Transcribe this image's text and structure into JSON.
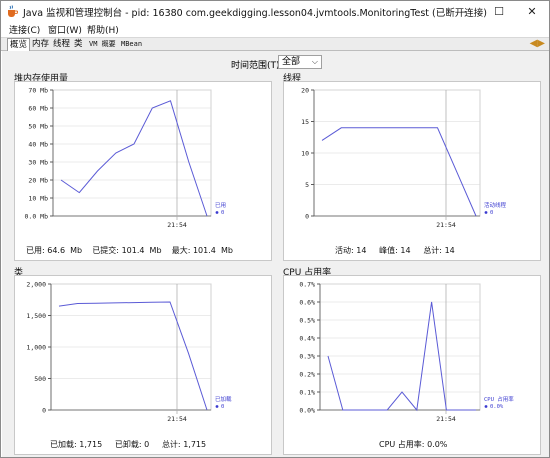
{
  "window": {
    "title": "Java 监视和管理控制台 - pid: 16380 com.geekdigging.lesson04.jvmtools.MonitoringTest (已断开连接)",
    "controls": {
      "minimize": "–",
      "maximize": "☐",
      "close": "✕"
    }
  },
  "menubar": [
    "连接(C)",
    "窗口(W)",
    "帮助(H)"
  ],
  "tabs": [
    "概览",
    "内存",
    "线程",
    "类",
    "VM 概要",
    "MBean"
  ],
  "active_tab": "概览",
  "time_range": {
    "label": "时间范围(T):",
    "value": "全部"
  },
  "panels": {
    "heap": {
      "title": "堆内存使用量",
      "legend_label": "已用",
      "legend_value": "0",
      "x_tick": "21:54",
      "stats": {
        "used_label": "已用:",
        "used_value": "64.6  Mb",
        "committed_label": "已提交:",
        "committed_value": "101.4  Mb",
        "max_label": "最大:",
        "max_value": "101.4  Mb"
      }
    },
    "threads": {
      "title": "线程",
      "legend_label": "活动线程",
      "legend_value": "0",
      "x_tick": "21:54",
      "stats": {
        "live_label": "活动:",
        "live_value": "14",
        "peak_label": "峰值:",
        "peak_value": "14",
        "total_label": "总计:",
        "total_value": "14"
      }
    },
    "classes": {
      "title": "类",
      "legend_label": "已加载",
      "legend_value": "0",
      "x_tick": "21:54",
      "stats": {
        "loaded_label": "已加载:",
        "loaded_value": "1,715",
        "unloaded_label": "已卸载:",
        "unloaded_value": "0",
        "total_label": "总计:",
        "total_value": "1,715"
      }
    },
    "cpu": {
      "title": "CPU 占用率",
      "legend_label": "CPU 占用率",
      "legend_value": "0.0%",
      "x_tick": "21:54",
      "stats": {
        "usage_label": "CPU 占用率:",
        "usage_value": "0.0%"
      }
    }
  },
  "colors": {
    "series": "#5b5bd6",
    "legend": "#3a3ad0",
    "grid": "#d8d8d8",
    "cursor": "#b0b0b0"
  },
  "chart_data": [
    {
      "type": "line",
      "title": "堆内存使用量",
      "series": [
        {
          "name": "已用",
          "x": [
            0,
            1,
            2,
            3,
            4,
            5,
            6,
            7,
            8
          ],
          "values": [
            20,
            13,
            25,
            35,
            40,
            60,
            64,
            30,
            0
          ]
        }
      ],
      "yticks": [
        "0.0 Mb",
        "10 Mb",
        "20 Mb",
        "30 Mb",
        "40 Mb",
        "50 Mb",
        "60 Mb",
        "70 Mb"
      ],
      "ylim": [
        0,
        70
      ]
    },
    {
      "type": "line",
      "title": "线程",
      "series": [
        {
          "name": "活动线程",
          "x": [
            0,
            1,
            2,
            3,
            4,
            5,
            6,
            7,
            8
          ],
          "values": [
            12,
            14,
            14,
            14,
            14,
            14,
            14,
            7,
            0
          ]
        }
      ],
      "yticks": [
        "0",
        "5",
        "10",
        "15",
        "20"
      ],
      "ylim": [
        0,
        20
      ]
    },
    {
      "type": "line",
      "title": "类",
      "series": [
        {
          "name": "已加载",
          "x": [
            0,
            1,
            2,
            3,
            4,
            5,
            6,
            7,
            8
          ],
          "values": [
            1650,
            1690,
            1695,
            1700,
            1705,
            1710,
            1715,
            900,
            0
          ]
        }
      ],
      "yticks": [
        "0",
        "500",
        "1,000",
        "1,500",
        "2,000"
      ],
      "ylim": [
        0,
        2000
      ]
    },
    {
      "type": "line",
      "title": "CPU 占用率",
      "series": [
        {
          "name": "CPU 占用率",
          "x": [
            0,
            1,
            2,
            3,
            4,
            5,
            6,
            7,
            8,
            9,
            10
          ],
          "values": [
            0.3,
            0.0,
            0.0,
            0.0,
            0.0,
            0.1,
            0.0,
            0.6,
            0.0,
            0.0,
            0.0
          ]
        }
      ],
      "yticks": [
        "0.0%",
        "0.1%",
        "0.2%",
        "0.3%",
        "0.4%",
        "0.5%",
        "0.6%",
        "0.7%"
      ],
      "ylim": [
        0,
        0.7
      ]
    }
  ]
}
